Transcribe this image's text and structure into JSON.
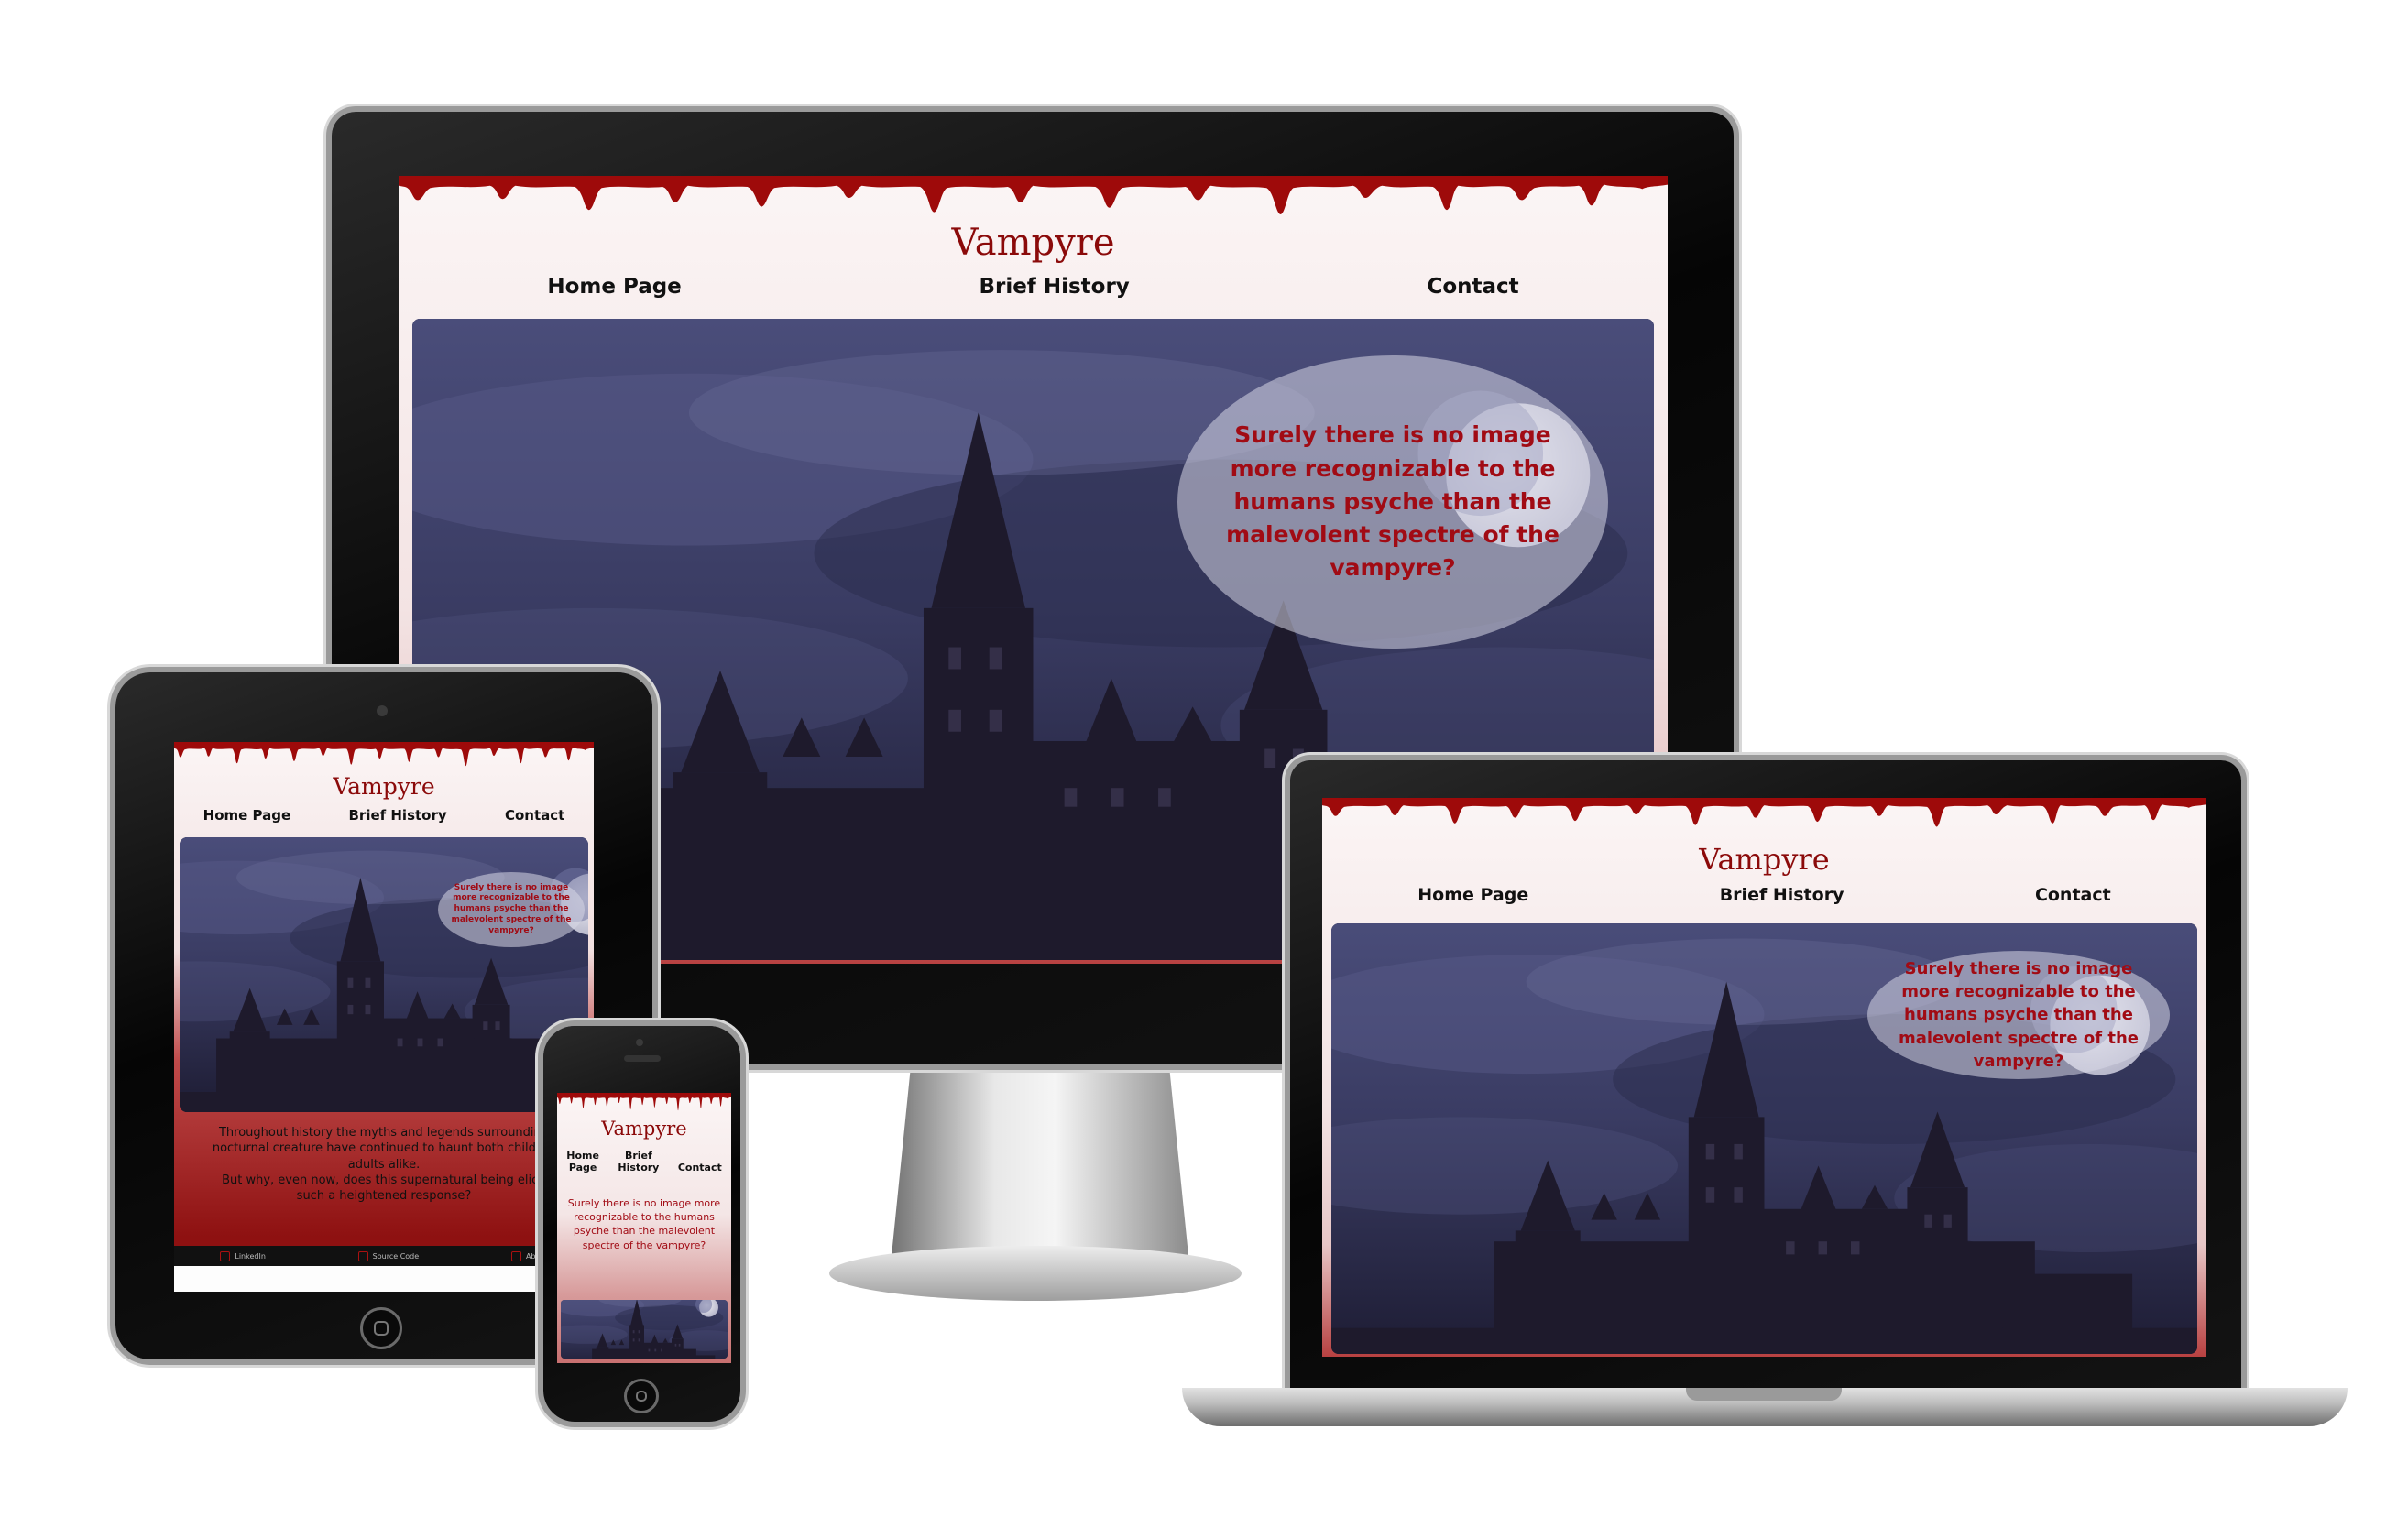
{
  "site": {
    "title": "Vampyre",
    "nav": {
      "home": "Home Page",
      "history": "Brief History",
      "contact": "Contact"
    },
    "hero_text": "Surely there is no image more recognizable to the humans psyche than the malevolent spectre of the vampyre?",
    "intro": {
      "line1": "Throughout history the myths and legends surrounding",
      "line2": "nocturnal creature have continued to haunt both children",
      "line3": "adults alike.",
      "line4": "But why, even now, does this supernatural being elicit",
      "line5": "such a heightened response?"
    },
    "footer": {
      "linkedin": "LinkedIn",
      "source": "Source Code",
      "about": "About"
    }
  },
  "phone_nav": {
    "home_1": "Home",
    "home_2": "Page",
    "history_1": "Brief",
    "history_2": "History",
    "contact": "Contact"
  },
  "colors": {
    "blood": "#9e0a0a",
    "accent_text": "#a10b14",
    "title": "#8b0a0a",
    "sky": "#3a3c63",
    "castle": "#1e1a2c"
  },
  "icons": [
    "monitor-device",
    "laptop-device",
    "tablet-device",
    "phone-device",
    "moon-icon",
    "castle-illustration"
  ]
}
